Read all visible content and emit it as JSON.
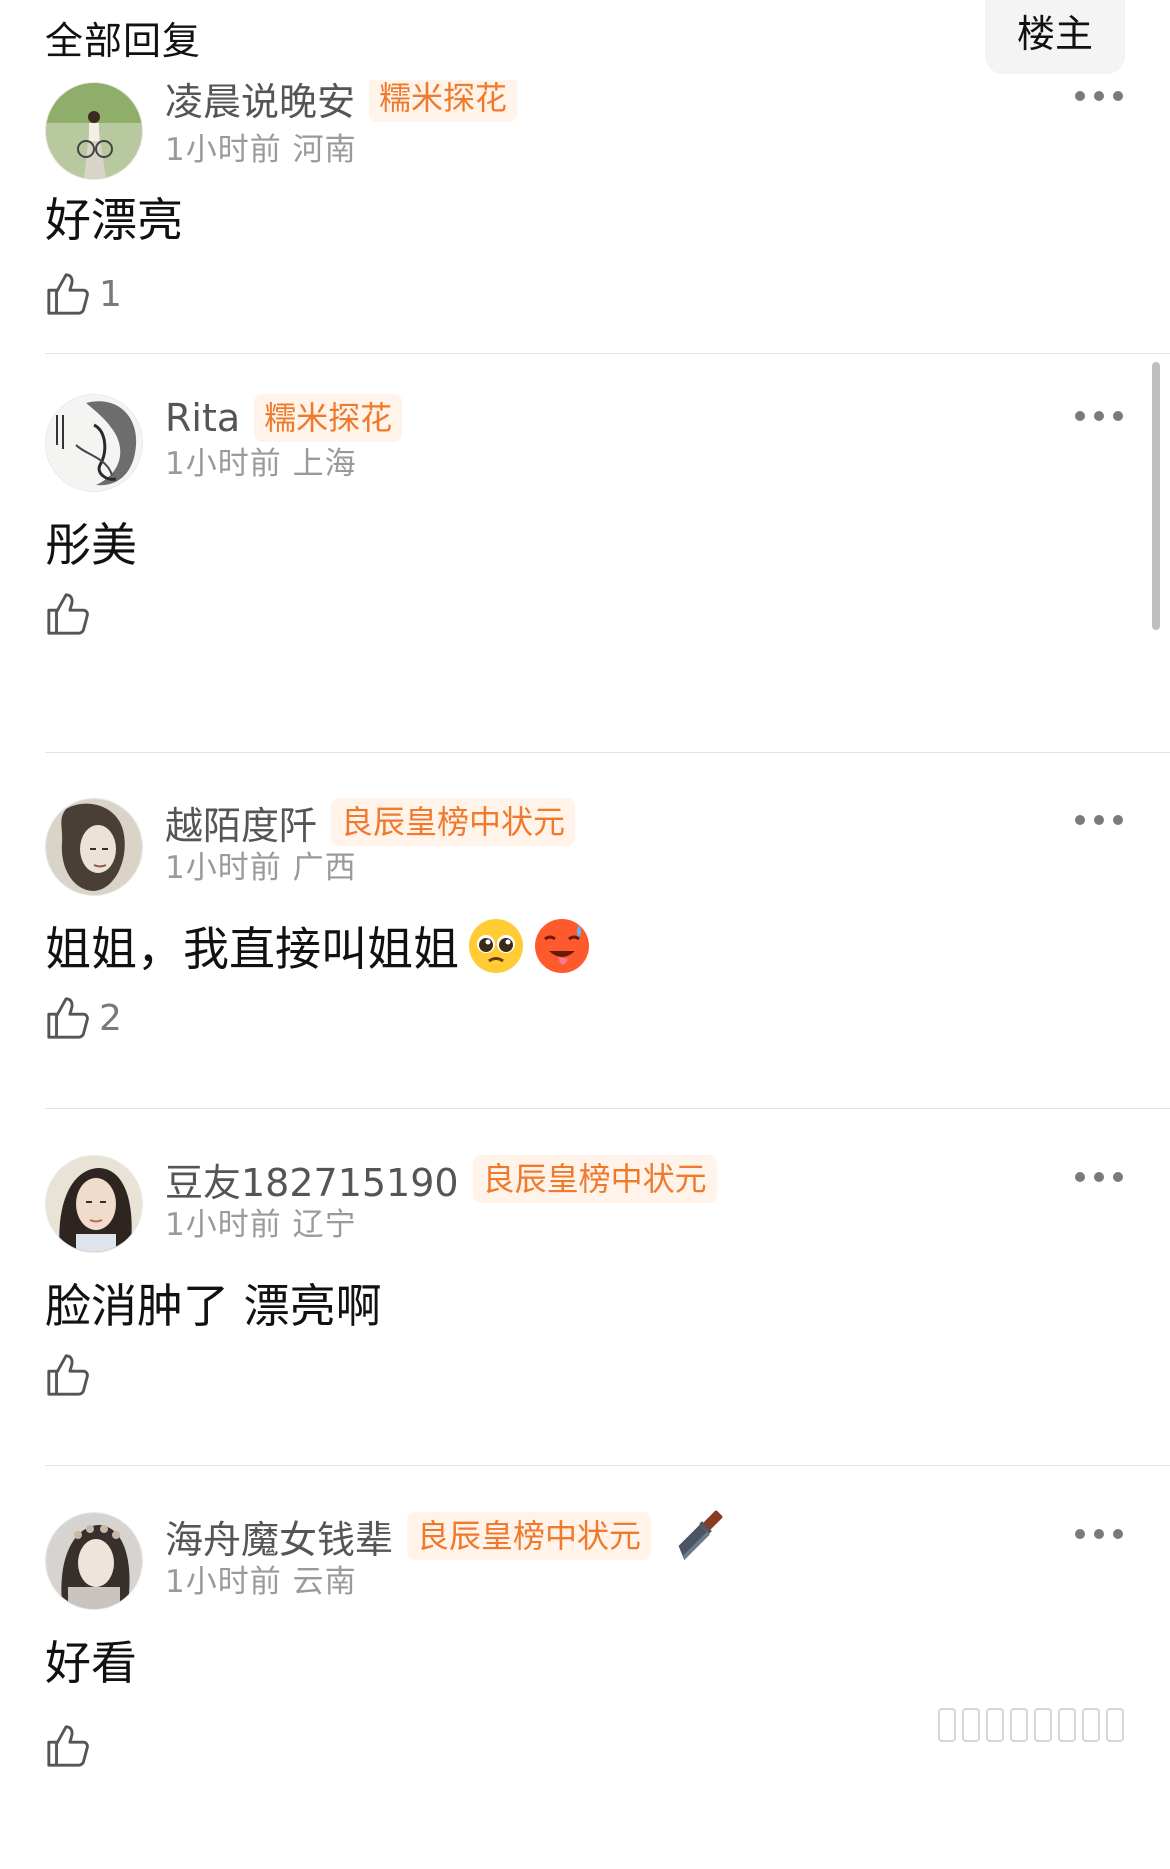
{
  "header": {
    "title": "全部回复",
    "filter_label": "楼主"
  },
  "colors": {
    "badge_bg": "#fff3ea",
    "badge_text": "#f07a2c",
    "meta": "#9a9a9a",
    "divider": "#e3e3e3"
  },
  "comments": [
    {
      "name": "凌晨说晚安",
      "badge": "糯米探花",
      "time": "1小时前",
      "location": "河南",
      "text": "好漂亮",
      "likes": "1"
    },
    {
      "name": "Rita",
      "badge": "糯米探花",
      "time": "1小时前",
      "location": "上海",
      "text": "彤美",
      "likes": ""
    },
    {
      "name": "越陌度阡",
      "badge": "良辰皇榜中状元",
      "time": "1小时前",
      "location": "广西",
      "text": "姐姐，我直接叫姐姐",
      "likes": "2",
      "emojis": [
        "pleading-face",
        "hot-face"
      ]
    },
    {
      "name": "豆友182715190",
      "badge": "良辰皇榜中状元",
      "time": "1小时前",
      "location": "辽宁",
      "text": "脸消肿了 漂亮啊",
      "likes": ""
    },
    {
      "name": "海舟魔女钱辈",
      "badge": "良辰皇榜中状元",
      "time": "1小时前",
      "location": "云南",
      "text": "好看",
      "likes": "",
      "extra_icon": "knife-icon"
    }
  ]
}
